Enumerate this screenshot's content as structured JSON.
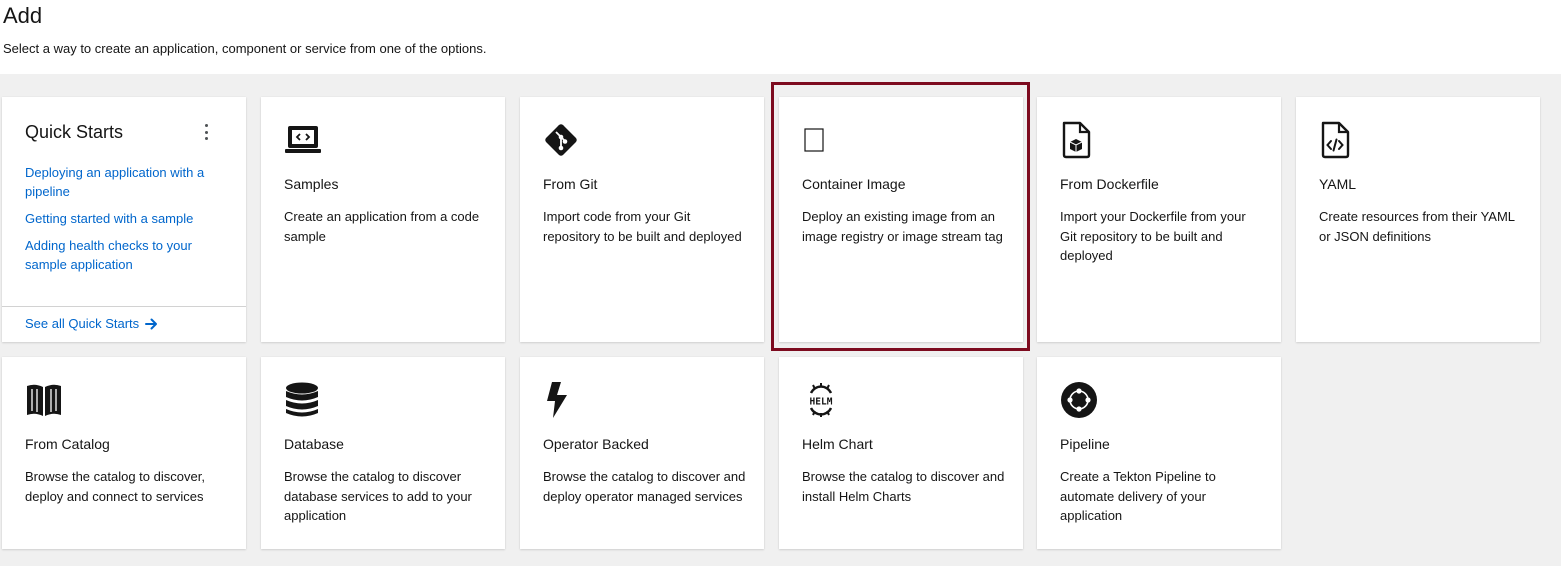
{
  "header": {
    "title": "Add",
    "subtitle": "Select a way to create an application, component or service from one of the options."
  },
  "quick_starts": {
    "title": "Quick Starts",
    "links": [
      "Deploying an application with a pipeline",
      "Getting started with a sample",
      "Adding health checks to your sample application"
    ],
    "see_all": "See all Quick Starts"
  },
  "cards": [
    {
      "title": "Samples",
      "description": "Create an application from a code sample",
      "icon": "code-laptop-icon"
    },
    {
      "title": "From Git",
      "description": "Import code from your Git repository to be built and deployed",
      "icon": "git-icon"
    },
    {
      "title": "Container Image",
      "description": "Deploy an existing image from an image registry or image stream tag",
      "icon": "container-image-icon"
    },
    {
      "title": "From Dockerfile",
      "description": "Import your Dockerfile from your Git repository to be built and deployed",
      "icon": "dockerfile-icon"
    },
    {
      "title": "YAML",
      "description": "Create resources from their YAML or JSON definitions",
      "icon": "yaml-file-icon"
    },
    {
      "title": "From Catalog",
      "description": "Browse the catalog to discover, deploy and connect to services",
      "icon": "book-icon"
    },
    {
      "title": "Database",
      "description": "Browse the catalog to discover database services to add to your application",
      "icon": "database-icon"
    },
    {
      "title": "Operator Backed",
      "description": "Browse the catalog to discover and deploy operator managed services",
      "icon": "bolt-icon"
    },
    {
      "title": "Helm Chart",
      "description": "Browse the catalog to discover and install Helm Charts",
      "icon": "helm-icon",
      "icon_text": "HELM"
    },
    {
      "title": "Pipeline",
      "description": "Create a Tekton Pipeline to automate delivery of your application",
      "icon": "pipeline-icon"
    }
  ],
  "colors": {
    "link": "#0066cc",
    "highlight_border": "#7d0b1f",
    "gallery_bg": "#f0f0f0"
  }
}
